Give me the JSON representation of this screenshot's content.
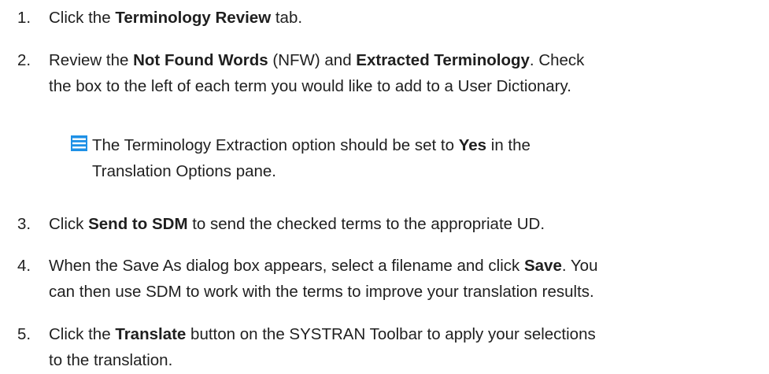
{
  "steps": [
    {
      "number": "1.",
      "parts": [
        {
          "t": "Click the "
        },
        {
          "b": "Terminology Review"
        },
        {
          "t": " tab."
        }
      ]
    },
    {
      "number": "2.",
      "lines": [
        [
          {
            "t": "Review the "
          },
          {
            "b": "Not Found Words"
          },
          {
            "t": " (NFW) and "
          },
          {
            "b": "Extracted Terminology"
          },
          {
            "t": ". Check"
          }
        ],
        [
          {
            "t": "the box to the left of each term you would like to add to a User Dictionary."
          }
        ]
      ]
    },
    {
      "number": "3.",
      "parts": [
        {
          "t": "Click "
        },
        {
          "b": "Send to SDM"
        },
        {
          "t": " to send the checked terms to the appropriate UD."
        }
      ]
    },
    {
      "number": "4.",
      "lines": [
        [
          {
            "t": "When the Save As dialog box appears, select a filename and click "
          },
          {
            "b": "Save"
          },
          {
            "t": ". You"
          }
        ],
        [
          {
            "t": "can then use SDM to work with the terms to improve your translation results."
          }
        ]
      ]
    },
    {
      "number": "5.",
      "lines": [
        [
          {
            "t": "Click the "
          },
          {
            "b": "Translate"
          },
          {
            "t": " button on the SYSTRAN Toolbar to apply your selections"
          }
        ],
        [
          {
            "t": "to the translation."
          }
        ]
      ]
    }
  ],
  "note": {
    "icon": "note-icon",
    "icon_color": "#1e90e6",
    "line1_pre": "The Terminology Extraction option should be set to ",
    "line1_bold": "Yes",
    "line1_post": " in the",
    "line2": "Translation Options pane."
  }
}
